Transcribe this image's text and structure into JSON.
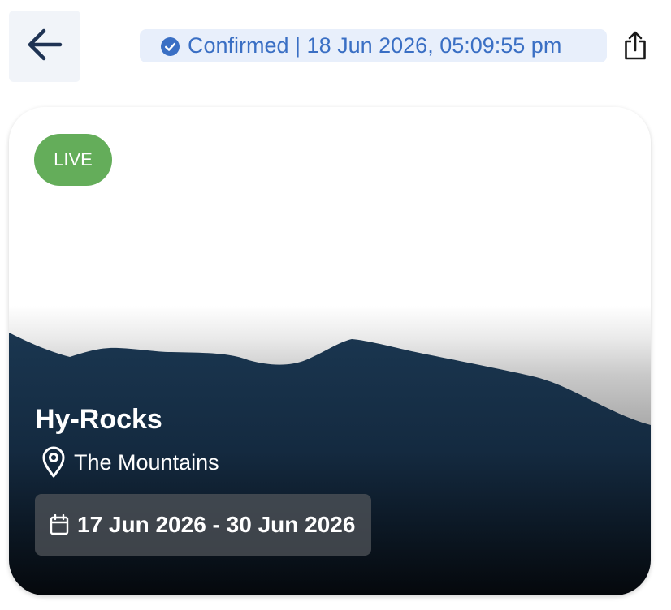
{
  "header": {
    "back_icon": "arrow-left-icon",
    "status_icon": "check-circle-icon",
    "status_text": "Confirmed | 18 Jun 2026, 05:09:55 pm",
    "share_icon": "share-icon",
    "colors": {
      "status_bg": "#e8effb",
      "status_text": "#3a6fc4",
      "back_bg": "#f1f4f9",
      "icon_dark": "#1f3354"
    }
  },
  "event": {
    "badge": "LIVE",
    "title": "Hy-Rocks",
    "location_icon": "location-pin-icon",
    "location": "The Mountains",
    "date_icon": "calendar-icon",
    "dates": "17 Jun 2026 - 30 Jun 2026",
    "colors": {
      "badge_bg": "#64ad5a",
      "mountain_top": "#1a3650",
      "mountain_bottom": "#05080c"
    }
  }
}
